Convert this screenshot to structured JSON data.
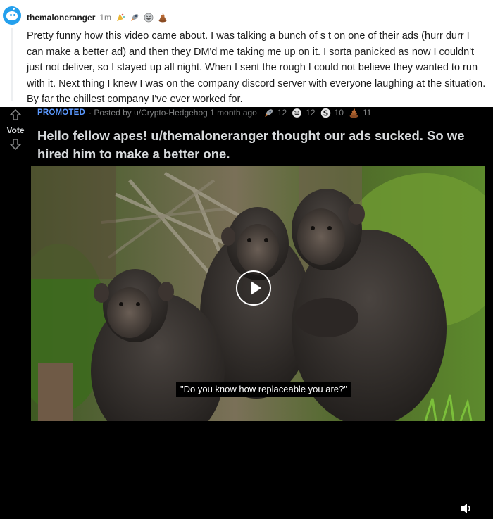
{
  "comment": {
    "username": "themaloneranger",
    "timestamp": "1m",
    "awards": [
      "party-award-icon",
      "rocket-award-icon",
      "laughing-award-icon",
      "poop-award-icon"
    ],
    "body": "Pretty funny how this video came about. I was talking a bunch of s  t on one of their ads (hurr durr I can make a better ad) and then they DM'd me taking me up on it. I sorta panicked as now I couldn't just not deliver, so I stayed up all night. When I sent the rough I could not believe they wanted to run with it. Next thing I knew I was on the company discord server with everyone laughing at the situation. By far the chillest company I've ever worked for."
  },
  "post": {
    "vote_label": "Vote",
    "promoted_label": "PROMOTED",
    "posted_by": "· Posted by u/Crypto-Hedgehog 1 month ago",
    "awards": [
      {
        "icon": "rocket-award-icon",
        "count": "12"
      },
      {
        "icon": "laughing-award-icon",
        "count": "12"
      },
      {
        "icon": "silver-s-award-icon",
        "count": "10"
      },
      {
        "icon": "poop-award-icon",
        "count": "11"
      }
    ],
    "title": "Hello fellow apes! u/themaloneranger thought our ads sucked. So we hired him to make a better one.",
    "video": {
      "subtitle": "\"Do you know how replaceable you are?\"",
      "play_icon": "play-icon",
      "volume_icon": "volume-icon"
    }
  },
  "colors": {
    "comment_bg": "#ffffff",
    "post_bg": "#000000",
    "promoted": "#5b99ff",
    "title": "#d7dadc",
    "meta": "#818384"
  }
}
